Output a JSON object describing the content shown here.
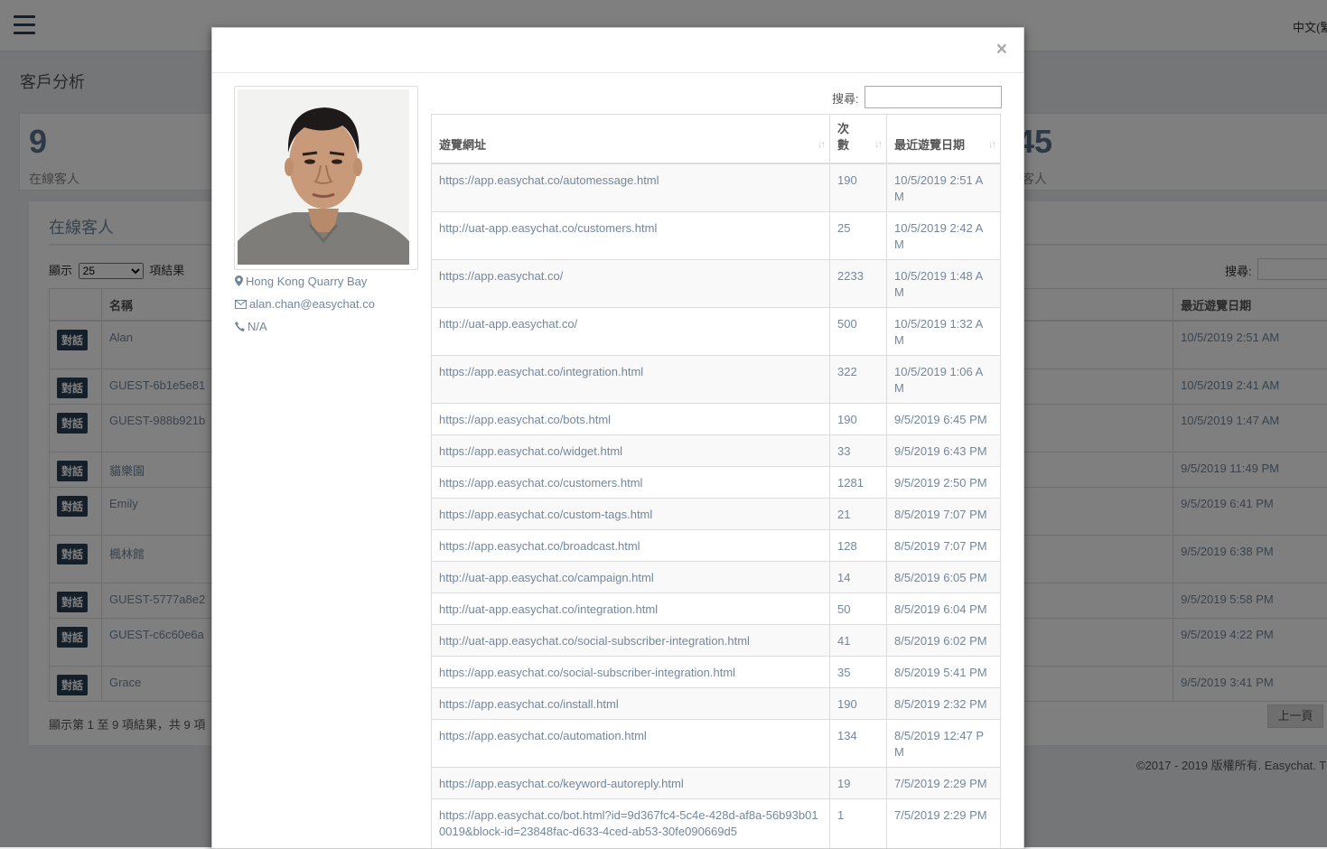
{
  "topbar": {
    "lang": "中文(繁"
  },
  "page_title": "客戶分析",
  "stats": [
    {
      "num": "9",
      "label": "在線客人"
    },
    {
      "num": "45",
      "label": "客人"
    }
  ],
  "panel": {
    "title": "在線客人",
    "show_prefix": "顯示",
    "page_size": "25",
    "show_suffix": "項結果",
    "search_label": "搜尋:",
    "col_name": "名稱",
    "col_last_visit": "最近遊覽日期",
    "chat_label": "對話",
    "rows": [
      {
        "name": "Alan",
        "last": "10/5/2019 2:51 AM"
      },
      {
        "name": "GUEST-6b1e5e81",
        "last": "10/5/2019 2:41 AM"
      },
      {
        "name": "GUEST-988b921b",
        "last": "10/5/2019 1:47 AM"
      },
      {
        "name": "貓樂園",
        "last": "9/5/2019 11:49 PM"
      },
      {
        "name": "Emily",
        "last": "9/5/2019 6:41 PM"
      },
      {
        "name": "楓林館",
        "last": "9/5/2019 6:38 PM"
      },
      {
        "name": "GUEST-5777a8e2",
        "last": "9/5/2019 5:58 PM"
      },
      {
        "name": "GUEST-c6c60e6a",
        "last": "9/5/2019 4:22 PM"
      },
      {
        "name": "Grace",
        "last": "9/5/2019 3:41 PM"
      }
    ],
    "info": "顯示第 1 至 9 項結果，共 9 項",
    "prev_label": "上一頁"
  },
  "footer": "©2017 - 2019 版權所有. Easychat. T",
  "modal": {
    "close": "×",
    "location": "Hong Kong Quarry Bay",
    "email": "alan.chan@easychat.co",
    "phone": "N/A",
    "search_label": "搜尋:",
    "col_url": "遊覽網址",
    "col_count": "次數",
    "col_date": "最近遊覽日期",
    "rows": [
      {
        "url": "https://app.easychat.co/automessage.html",
        "count": "190",
        "date": "10/5/2019 2:51 AM"
      },
      {
        "url": "http://uat-app.easychat.co/customers.html",
        "count": "25",
        "date": "10/5/2019 2:42 AM"
      },
      {
        "url": "https://app.easychat.co/",
        "count": "2233",
        "date": "10/5/2019 1:48 AM"
      },
      {
        "url": "http://uat-app.easychat.co/",
        "count": "500",
        "date": "10/5/2019 1:32 AM"
      },
      {
        "url": "https://app.easychat.co/integration.html",
        "count": "322",
        "date": "10/5/2019 1:06 AM"
      },
      {
        "url": "https://app.easychat.co/bots.html",
        "count": "190",
        "date": "9/5/2019 6:45 PM"
      },
      {
        "url": "https://app.easychat.co/widget.html",
        "count": "33",
        "date": "9/5/2019 6:43 PM"
      },
      {
        "url": "https://app.easychat.co/customers.html",
        "count": "1281",
        "date": "9/5/2019 2:50 PM"
      },
      {
        "url": "https://app.easychat.co/custom-tags.html",
        "count": "21",
        "date": "8/5/2019 7:07 PM"
      },
      {
        "url": "https://app.easychat.co/broadcast.html",
        "count": "128",
        "date": "8/5/2019 7:07 PM"
      },
      {
        "url": "http://uat-app.easychat.co/campaign.html",
        "count": "14",
        "date": "8/5/2019 6:05 PM"
      },
      {
        "url": "http://uat-app.easychat.co/integration.html",
        "count": "50",
        "date": "8/5/2019 6:04 PM"
      },
      {
        "url": "http://uat-app.easychat.co/social-subscriber-integration.html",
        "count": "41",
        "date": "8/5/2019 6:02 PM"
      },
      {
        "url": "https://app.easychat.co/social-subscriber-integration.html",
        "count": "35",
        "date": "8/5/2019 5:41 PM"
      },
      {
        "url": "https://app.easychat.co/install.html",
        "count": "190",
        "date": "8/5/2019 2:32 PM"
      },
      {
        "url": "https://app.easychat.co/automation.html",
        "count": "134",
        "date": "8/5/2019 12:47 PM"
      },
      {
        "url": "https://app.easychat.co/keyword-autoreply.html",
        "count": "19",
        "date": "7/5/2019 2:29 PM"
      },
      {
        "url": "https://app.easychat.co/bot.html?id=9d367fc4-5c4e-428d-af8a-56b93b010019&block-id=23848fac-d633-4ced-ab53-30fe090669d5",
        "count": "1",
        "date": "7/5/2019 2:29 PM"
      }
    ]
  }
}
